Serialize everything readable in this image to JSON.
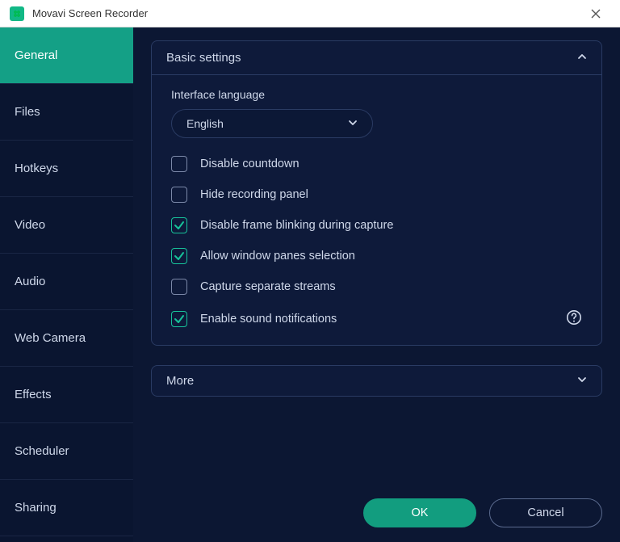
{
  "window": {
    "title": "Movavi Screen Recorder"
  },
  "sidebar": {
    "items": [
      {
        "label": "General",
        "active": true
      },
      {
        "label": "Files",
        "active": false
      },
      {
        "label": "Hotkeys",
        "active": false
      },
      {
        "label": "Video",
        "active": false
      },
      {
        "label": "Audio",
        "active": false
      },
      {
        "label": "Web Camera",
        "active": false
      },
      {
        "label": "Effects",
        "active": false
      },
      {
        "label": "Scheduler",
        "active": false
      },
      {
        "label": "Sharing",
        "active": false
      }
    ]
  },
  "panel": {
    "title": "Basic settings",
    "expanded": true,
    "language_label": "Interface language",
    "language_value": "English",
    "checks": [
      {
        "label": "Disable countdown",
        "checked": false
      },
      {
        "label": "Hide recording panel",
        "checked": false
      },
      {
        "label": "Disable frame blinking during capture",
        "checked": true
      },
      {
        "label": "Allow window panes selection",
        "checked": true
      },
      {
        "label": "Capture separate streams",
        "checked": false
      },
      {
        "label": "Enable sound notifications",
        "checked": true,
        "help": true
      }
    ]
  },
  "more": {
    "title": "More",
    "expanded": false
  },
  "footer": {
    "ok": "OK",
    "cancel": "Cancel"
  },
  "colors": {
    "accent": "#14a086",
    "bg": "#0c1733",
    "panel_border": "#2a3b63"
  }
}
